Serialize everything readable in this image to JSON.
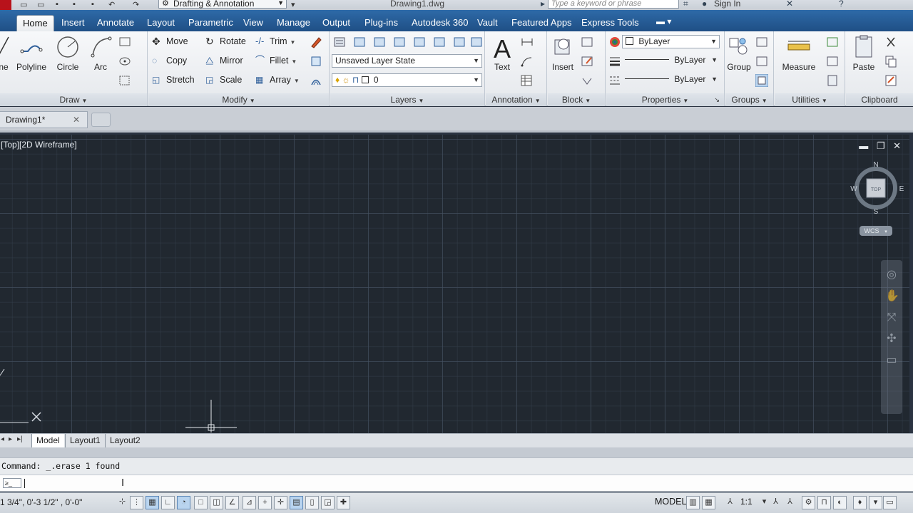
{
  "titlebar": {
    "workspace": "Drafting & Annotation",
    "document_title": "Drawing1.dwg",
    "search_placeholder": "Type a keyword or phrase",
    "sign_in": "Sign In"
  },
  "tabs": [
    "Home",
    "Insert",
    "Annotate",
    "Layout",
    "Parametric",
    "View",
    "Manage",
    "Output",
    "Plug-ins",
    "Autodesk 360",
    "Vault",
    "Featured Apps",
    "Express Tools"
  ],
  "ribbon": {
    "draw": {
      "title": "Draw",
      "line": "ne",
      "polyline": "Polyline",
      "circle": "Circle",
      "arc": "Arc"
    },
    "modify": {
      "title": "Modify",
      "move": "Move",
      "rotate": "Rotate",
      "trim": "Trim",
      "copy": "Copy",
      "mirror": "Mirror",
      "fillet": "Fillet",
      "stretch": "Stretch",
      "scale": "Scale",
      "array": "Array"
    },
    "layers": {
      "title": "Layers",
      "layer_state": "Unsaved Layer State",
      "current_layer": "0"
    },
    "annotation": {
      "title": "Annotation",
      "text": "Text"
    },
    "block": {
      "title": "Block",
      "insert": "Insert"
    },
    "properties": {
      "title": "Properties",
      "color": "ByLayer",
      "linetype": "ByLayer",
      "lineweight": "ByLayer"
    },
    "groups": {
      "title": "Groups",
      "group": "Group"
    },
    "utilities": {
      "title": "Utilities",
      "measure": "Measure"
    },
    "clipboard": {
      "title": "Clipboard",
      "paste": "Paste"
    }
  },
  "doc_tab": {
    "name": "Drawing1*"
  },
  "viewport": {
    "label": "[Top][2D Wireframe]",
    "viewcube": {
      "n": "N",
      "s": "S",
      "e": "E",
      "w": "W",
      "face": "TOP",
      "wcs": "WCS"
    }
  },
  "layout_tabs": [
    "Model",
    "Layout1",
    "Layout2"
  ],
  "command": {
    "history": "Command: _.erase 1 found",
    "prompt_icon": "≥_"
  },
  "status": {
    "coords": "1 3/4\",   0'-3 1/2\"  , 0'-0\"",
    "model": "MODEL",
    "annotation_scale": "1:1"
  },
  "colors": {
    "tab_bar": "#2a5f9a",
    "canvas": "#212830",
    "ribbon": "#eef0f3"
  }
}
